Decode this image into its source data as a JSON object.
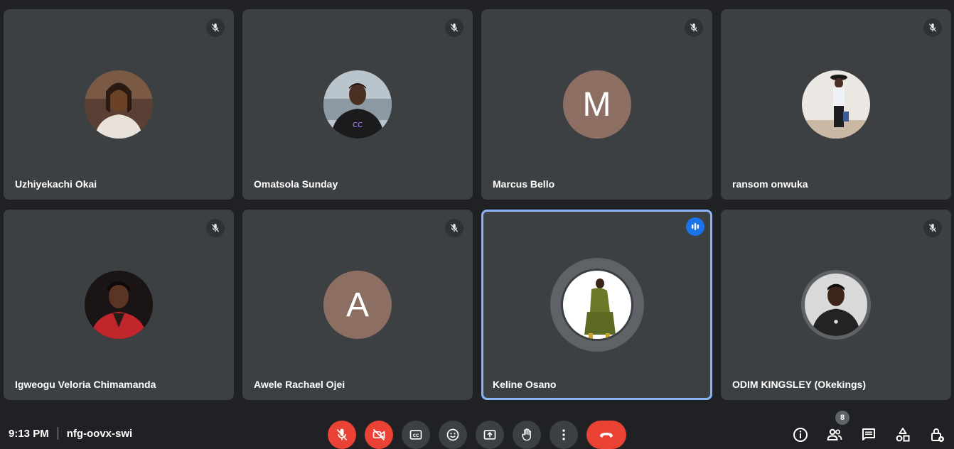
{
  "meeting": {
    "time": "9:13 PM",
    "code": "nfg-oovx-swi",
    "participant_count": "8"
  },
  "tiles": [
    {
      "name": "Uzhiyekachi Okai",
      "avatar": "photo",
      "muted": true
    },
    {
      "name": "Omatsola Sunday",
      "avatar": "photo",
      "muted": true
    },
    {
      "name": "Marcus Bello",
      "avatar": "letter",
      "letter": "M",
      "muted": true
    },
    {
      "name": "ransom onwuka",
      "avatar": "photo",
      "muted": true
    },
    {
      "name": "Igweogu Veloria Chimamanda",
      "avatar": "photo",
      "muted": true
    },
    {
      "name": "Awele Rachael Ojei",
      "avatar": "letter",
      "letter": "A",
      "muted": true
    },
    {
      "name": "Keline Osano",
      "avatar": "photo",
      "muted": false,
      "speaking": true
    },
    {
      "name": "ODIM KINGSLEY (Okekings)",
      "avatar": "photo",
      "muted": true
    }
  ],
  "controls": [
    {
      "icon": "mic-off-icon",
      "state": "off"
    },
    {
      "icon": "camera-off-icon",
      "state": "off"
    },
    {
      "icon": "captions-icon"
    },
    {
      "icon": "emoji-icon"
    },
    {
      "icon": "present-screen-icon"
    },
    {
      "icon": "raise-hand-icon"
    },
    {
      "icon": "more-options-icon"
    },
    {
      "icon": "leave-call-icon"
    }
  ],
  "right_controls": [
    {
      "icon": "meeting-info-icon"
    },
    {
      "icon": "people-icon"
    },
    {
      "icon": "chat-icon"
    },
    {
      "icon": "activities-icon"
    },
    {
      "icon": "host-controls-icon"
    }
  ],
  "colors": {
    "background": "#202124",
    "tile": "#3c4043",
    "letter_avatar": "#8d6e63",
    "speaking_border": "#8ab4f8",
    "speaking_badge": "#1a73e8",
    "danger": "#ea4335"
  }
}
